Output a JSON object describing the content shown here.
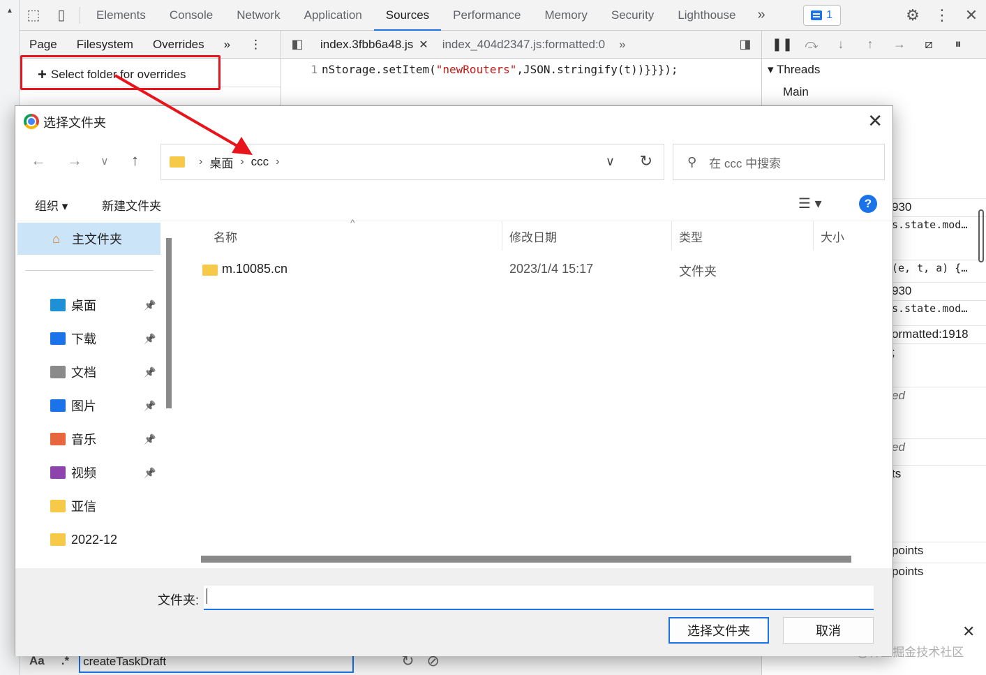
{
  "devtools": {
    "main_tabs": [
      "Elements",
      "Console",
      "Network",
      "Application",
      "Sources",
      "Performance",
      "Memory",
      "Security",
      "Lighthouse"
    ],
    "active_tab": "Sources",
    "issues_count": "1",
    "sub_tabs": [
      "Page",
      "Filesystem",
      "Overrides"
    ],
    "active_sub_tab": "Overrides",
    "select_folder_label": "Select folder for overrides",
    "editor_tabs": [
      {
        "label": "index.3fbb6a48.js",
        "closable": true
      },
      {
        "label": "index_404d2347.js:formatted:0",
        "closable": false
      }
    ],
    "code": {
      "line_number": "1",
      "prefix": "nStorage.setItem(",
      "string": "\"newRouters\"",
      "suffix": ",JSON.stringify(t))}}});"
    },
    "threads": {
      "header": "Threads",
      "main": "Main"
    },
    "right_rows": [
      "930",
      "s.state.mod…",
      "(e, t, a) {…",
      "930",
      "s.state.mod…",
      "ormatted:1918",
      ";",
      "ed",
      "ed",
      "ts",
      "points",
      "points"
    ],
    "search": {
      "aa": "Aa",
      "regex": ".*",
      "value": "createTaskDraft"
    },
    "watermark": "@稀土掘金技术社区"
  },
  "dialog": {
    "title": "选择文件夹",
    "breadcrumb": [
      "桌面",
      "ccc"
    ],
    "search_placeholder": "在 ccc 中搜索",
    "toolbar": {
      "organize": "组织 ▾",
      "new_folder": "新建文件夹",
      "help": "?"
    },
    "sidebar": {
      "home": "主文件夹",
      "items": [
        {
          "label": "桌面",
          "icon": "desktop-icon",
          "color": "#1e90d6",
          "pinned": true
        },
        {
          "label": "下载",
          "icon": "download-icon",
          "color": "#1a73e8",
          "pinned": true
        },
        {
          "label": "文档",
          "icon": "document-icon",
          "color": "#8a8a8a",
          "pinned": true
        },
        {
          "label": "图片",
          "icon": "pictures-icon",
          "color": "#1a73e8",
          "pinned": true
        },
        {
          "label": "音乐",
          "icon": "music-icon",
          "color": "#e8663d",
          "pinned": true
        },
        {
          "label": "视频",
          "icon": "video-icon",
          "color": "#8e44ad",
          "pinned": true
        },
        {
          "label": "亚信",
          "icon": "folder-icon",
          "color": "#f7c948",
          "pinned": false
        },
        {
          "label": "2022-12",
          "icon": "folder-icon",
          "color": "#f7c948",
          "pinned": false
        }
      ]
    },
    "columns": [
      "名称",
      "修改日期",
      "类型",
      "大小"
    ],
    "files": [
      {
        "name": "m.10085.cn",
        "modified": "2023/1/4 15:17",
        "type": "文件夹",
        "size": ""
      }
    ],
    "footer": {
      "folder_label": "文件夹:",
      "folder_value": "",
      "ok": "选择文件夹",
      "cancel": "取消"
    }
  }
}
